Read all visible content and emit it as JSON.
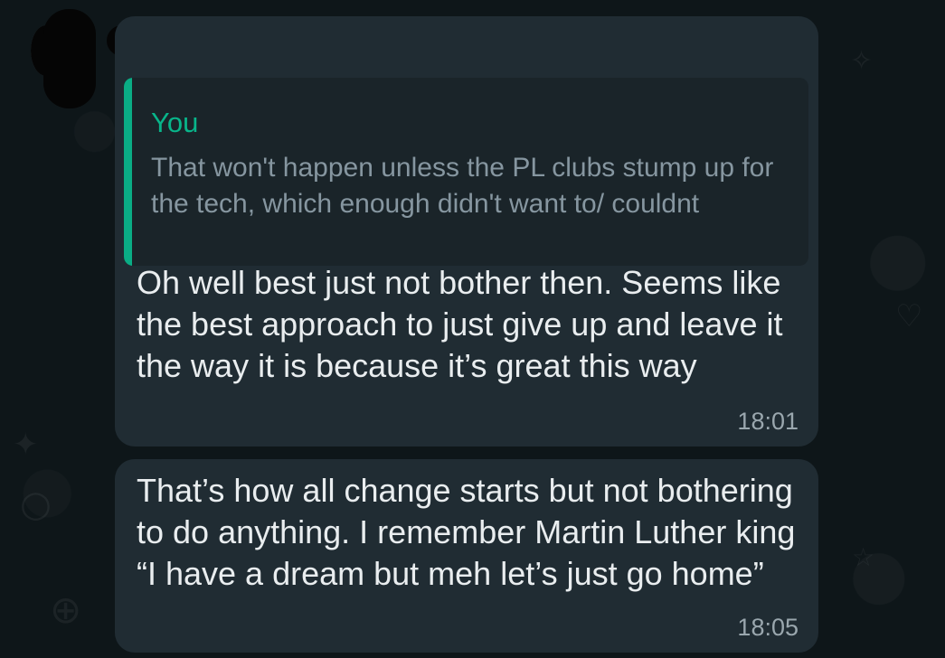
{
  "quoted_message": {
    "author": "You",
    "text": "That won't happen unless the PL clubs stump up for the tech, which enough didn't want to/ couldnt"
  },
  "messages": [
    {
      "text": "Oh well best just not bother then. Seems like the best approach to just give up and leave it the way it is because it’s great this way",
      "time": "18:01"
    },
    {
      "text": "That’s how all change starts but not bothering to do anything.  I remember Martin Luther king “I have a dream but meh let’s just go home”",
      "time": "18:05"
    }
  ],
  "colors": {
    "background": "#0e1619",
    "bubble": "#202c33",
    "quote_accent": "#06cf9c",
    "text": "#e9edef",
    "muted_text": "#8696a0"
  },
  "icons": [
    "avatar",
    "background-doodles"
  ]
}
